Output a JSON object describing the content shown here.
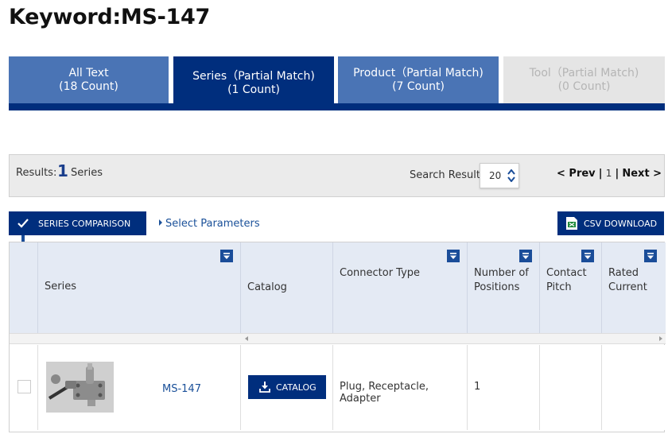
{
  "page_title": "Keyword:MS-147",
  "tabs": [
    {
      "name": "All Text",
      "count": "(18 Count)"
    },
    {
      "name": "Series（Partial Match)",
      "count": "(1 Count)"
    },
    {
      "name": "Product（Partial Match)",
      "count": "(7 Count)"
    },
    {
      "name": "Tool（Partial Match)",
      "count": "(0 Count)"
    }
  ],
  "results": {
    "label": "Results:",
    "count": "1",
    "unit": "Series",
    "search_result_label": "Search Result",
    "per_page": "20"
  },
  "pager": {
    "prev": "< Prev",
    "sep1": "|",
    "page": "1",
    "sep2": "|",
    "next": "Next >"
  },
  "toolbar": {
    "series_comparison": "SERIES COMPARISON",
    "select_parameters": "Select Parameters",
    "csv_download": "CSV DOWNLOAD"
  },
  "table": {
    "headers": {
      "series": "Series",
      "catalog": "Catalog",
      "connector_type": "Connector Type",
      "positions_1": "Number of",
      "positions_2": "Positions",
      "pitch_1": "Contact",
      "pitch_2": "Pitch",
      "current_1": "Rated",
      "current_2": "Current"
    },
    "rows": [
      {
        "series": "MS-147",
        "catalog_button": "CATALOG",
        "connector_type": "Plug, Receptacle, Adapter",
        "positions": "1",
        "pitch": "",
        "current": ""
      }
    ]
  },
  "colors": {
    "navy": "#002e7d",
    "tab_blue": "#4a74b5",
    "tab_disabled": "#e5e5e5",
    "link": "#1a5099"
  },
  "icons": [
    "check-icon",
    "arrow-down-icon",
    "excel-icon",
    "sort-icon",
    "download-icon",
    "spinner-icon"
  ]
}
